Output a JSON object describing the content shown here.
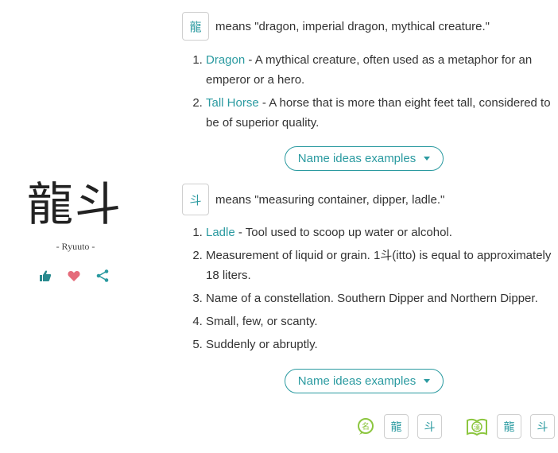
{
  "name": {
    "kanji": "龍斗",
    "reading": "- Ryuuto -"
  },
  "actions": [
    {
      "icon": "thumbs-up-icon",
      "color": "#2a8a8f"
    },
    {
      "icon": "heart-icon",
      "color": "#e56b7a"
    },
    {
      "icon": "share-icon",
      "color": "#2a9aa0"
    }
  ],
  "kanji_blocks": [
    {
      "char": "龍",
      "means": "means \"dragon, imperial dragon, mythical creature.\"",
      "meanings": [
        {
          "link": "Dragon",
          "text": " - A mythical creature, often used as a metaphor for an emperor or a hero."
        },
        {
          "link": "Tall Horse",
          "text": " - A horse that is more than eight feet tall, considered to be of superior quality."
        }
      ],
      "button": "Name ideas examples"
    },
    {
      "char": "斗",
      "means": "means \"measuring container, dipper, ladle.\"",
      "meanings": [
        {
          "link": "Ladle",
          "text": " - Tool used to scoop up water or alcohol."
        },
        {
          "link": "",
          "text": "Measurement of liquid or grain. 1斗(itto) is equal to approximately 18 liters."
        },
        {
          "link": "",
          "text": "Name of a constellation. Southern Dipper and Northern Dipper."
        },
        {
          "link": "",
          "text": "Small, few, or scanty."
        },
        {
          "link": "",
          "text": "Suddenly or abruptly."
        }
      ],
      "button": "Name ideas examples"
    }
  ],
  "bottom": {
    "group1": {
      "icon_text": "名",
      "chars": [
        "龍",
        "斗"
      ]
    },
    "group2": {
      "icon_text": "漢",
      "chars": [
        "龍",
        "斗"
      ]
    }
  },
  "colors": {
    "accent": "#2a9aa0",
    "green": "#8cc63f"
  }
}
